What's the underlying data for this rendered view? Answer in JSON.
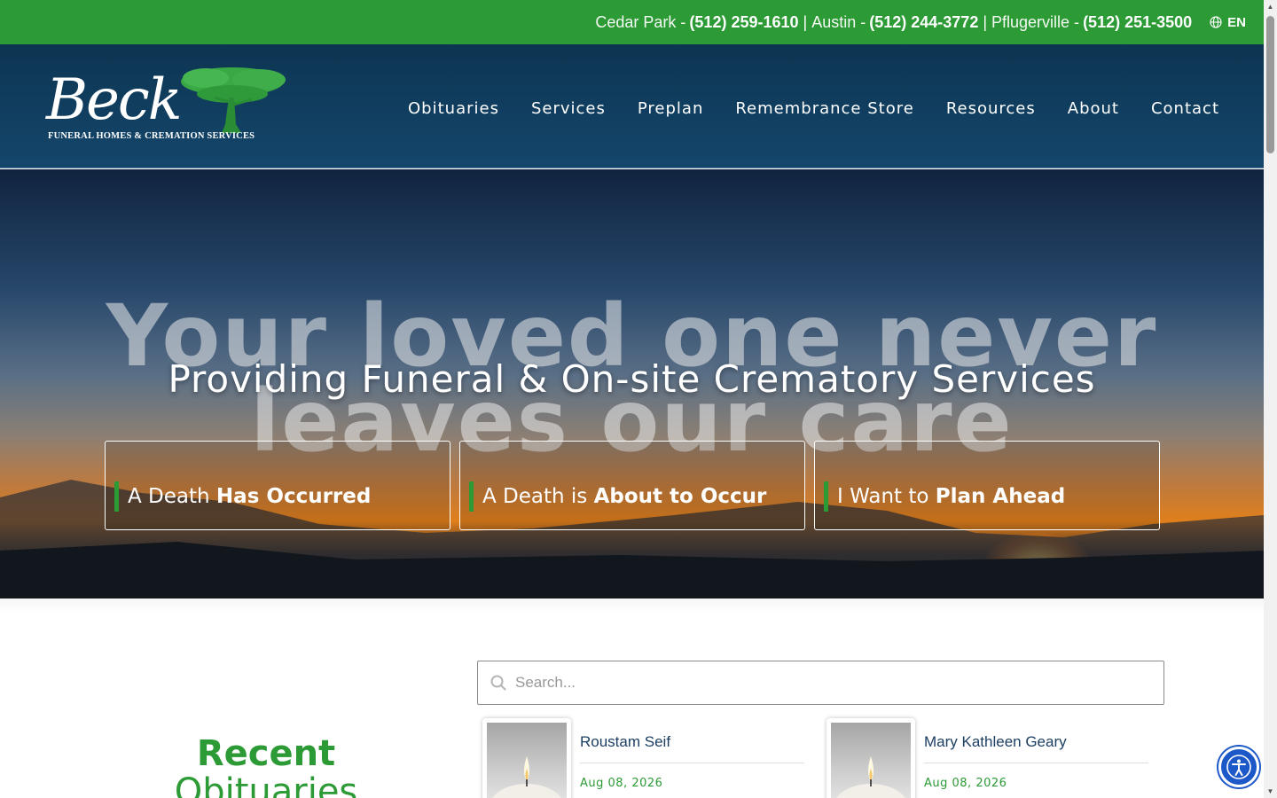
{
  "topbar": {
    "locations": [
      {
        "name": "Cedar Park -",
        "phone": "(512) 259-1610"
      },
      {
        "name": "Austin -",
        "phone": "(512) 244-3772"
      },
      {
        "name": "Pflugerville -",
        "phone": "(512) 251-3500"
      }
    ],
    "separator": "|",
    "language": "EN"
  },
  "logo": {
    "script": "Beck",
    "tagline": "FUNERAL HOMES & CREMATION SERVICES"
  },
  "nav": [
    "Obituaries",
    "Services",
    "Preplan",
    "Remembrance Store",
    "Resources",
    "About",
    "Contact"
  ],
  "hero": {
    "background_text_line1": "Your loved one never",
    "background_text_line2": "leaves our care",
    "subtitle": "Providing Funeral & On-site Crematory Services",
    "ctas": [
      {
        "prefix": "A Death",
        "bold": "Has Occurred"
      },
      {
        "prefix": "A Death is",
        "bold": "About to Occur"
      },
      {
        "prefix": "I Want to",
        "bold": "Plan Ahead"
      }
    ]
  },
  "recent": {
    "line1": "Recent",
    "line2": "Obituaries"
  },
  "search": {
    "placeholder": "Search..."
  },
  "obituaries": [
    {
      "name": "Roustam Seif",
      "date": "Aug 08, 2026"
    },
    {
      "name": "Mary Kathleen Geary",
      "date": "Aug 08, 2026"
    }
  ],
  "colors": {
    "brand_green": "#2c9a35",
    "header_navy": "#14466b",
    "accessibility_blue": "#1d58c9"
  },
  "icons": [
    "globe-icon",
    "search-icon",
    "accessibility-icon",
    "candle-icon",
    "tree-logo-icon"
  ]
}
